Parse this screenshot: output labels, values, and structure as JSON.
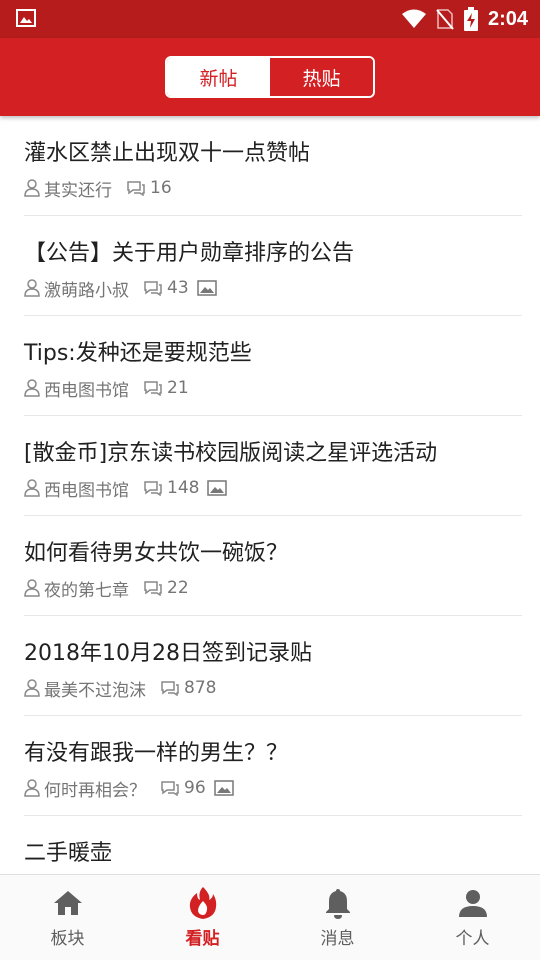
{
  "status_bar": {
    "time": "2:04",
    "icons": [
      "image-notification-icon",
      "wifi-icon",
      "no-sim-icon",
      "battery-charging-icon"
    ]
  },
  "header": {
    "tabs": [
      {
        "label": "新帖",
        "active": true
      },
      {
        "label": "热贴",
        "active": false
      }
    ]
  },
  "posts": [
    {
      "title": "灌水区禁止出现双十一点赞帖",
      "author": "其实还行",
      "replies": "16",
      "has_image": false
    },
    {
      "title": "【公告】关于用户勋章排序的公告",
      "author": "激萌路小叔",
      "replies": "43",
      "has_image": true
    },
    {
      "title": "Tips:发种还是要规范些",
      "author": "西电图书馆",
      "replies": "21",
      "has_image": false
    },
    {
      "title": "[散金币]京东读书校园版阅读之星评选活动",
      "author": "西电图书馆",
      "replies": "148",
      "has_image": true
    },
    {
      "title": "如何看待男女共饮一碗饭？",
      "author": "夜的第七章",
      "replies": "22",
      "has_image": false
    },
    {
      "title": "2018年10月28日签到记录贴",
      "author": "最美不过泡沫",
      "replies": "878",
      "has_image": false
    },
    {
      "title": "有没有跟我一样的男生？？",
      "author": "何时再相会？",
      "replies": "96",
      "has_image": true
    },
    {
      "title": "二手暖壶",
      "author": "",
      "replies": "",
      "has_image": false
    }
  ],
  "bottom_nav": [
    {
      "label": "板块",
      "icon": "home-icon",
      "active": false
    },
    {
      "label": "看贴",
      "icon": "fire-icon",
      "active": true
    },
    {
      "label": "消息",
      "icon": "bell-icon",
      "active": false
    },
    {
      "label": "个人",
      "icon": "person-icon",
      "active": false
    }
  ],
  "colors": {
    "primary": "#d32023",
    "status_bar": "#b71c1c",
    "text": "#212121",
    "meta": "#757575"
  }
}
